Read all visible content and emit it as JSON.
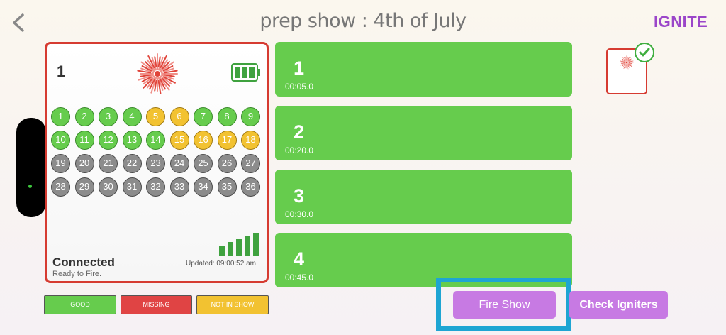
{
  "header": {
    "title": "prep show :  4th of July",
    "brand": "IGNITE"
  },
  "module": {
    "number": "1",
    "status_title": "Connected",
    "status_subtitle": "Ready to Fire.",
    "updated": "Updated: 09:00:52 am",
    "cues": [
      {
        "label": "1",
        "state": "good"
      },
      {
        "label": "2",
        "state": "good"
      },
      {
        "label": "3",
        "state": "good"
      },
      {
        "label": "4",
        "state": "good"
      },
      {
        "label": "5",
        "state": "notin"
      },
      {
        "label": "6",
        "state": "notin"
      },
      {
        "label": "7",
        "state": "good"
      },
      {
        "label": "8",
        "state": "good"
      },
      {
        "label": "9",
        "state": "good"
      },
      {
        "label": "10",
        "state": "good"
      },
      {
        "label": "11",
        "state": "good"
      },
      {
        "label": "12",
        "state": "good"
      },
      {
        "label": "13",
        "state": "good"
      },
      {
        "label": "14",
        "state": "good"
      },
      {
        "label": "15",
        "state": "notin"
      },
      {
        "label": "16",
        "state": "notin"
      },
      {
        "label": "17",
        "state": "notin"
      },
      {
        "label": "18",
        "state": "notin"
      },
      {
        "label": "19",
        "state": "unused"
      },
      {
        "label": "20",
        "state": "unused"
      },
      {
        "label": "21",
        "state": "unused"
      },
      {
        "label": "22",
        "state": "unused"
      },
      {
        "label": "23",
        "state": "unused"
      },
      {
        "label": "24",
        "state": "unused"
      },
      {
        "label": "25",
        "state": "unused"
      },
      {
        "label": "26",
        "state": "unused"
      },
      {
        "label": "27",
        "state": "unused"
      },
      {
        "label": "28",
        "state": "unused"
      },
      {
        "label": "29",
        "state": "unused"
      },
      {
        "label": "30",
        "state": "unused"
      },
      {
        "label": "31",
        "state": "unused"
      },
      {
        "label": "32",
        "state": "unused"
      },
      {
        "label": "33",
        "state": "unused"
      },
      {
        "label": "34",
        "state": "unused"
      },
      {
        "label": "35",
        "state": "unused"
      },
      {
        "label": "36",
        "state": "unused"
      }
    ]
  },
  "legend": {
    "good": "GOOD",
    "missing": "MISSING",
    "not_in_show": "NOT IN SHOW"
  },
  "cue_list": [
    {
      "number": "1",
      "time": "00:05.0"
    },
    {
      "number": "2",
      "time": "00:20.0"
    },
    {
      "number": "3",
      "time": "00:30.0"
    },
    {
      "number": "4",
      "time": "00:45.0"
    }
  ],
  "buttons": {
    "fire_show": "Fire Show",
    "check_igniters": "Check Igniters"
  },
  "colors": {
    "good": "#66cc4d",
    "missing": "#e04444",
    "not_in_show": "#f2c231",
    "unused": "#8c8c8c",
    "accent": "#c77ae3",
    "brand": "#9b46c9",
    "module_border": "#d63b31",
    "highlight": "#1ea5d3"
  },
  "icons": {
    "back": "chevron-left-icon",
    "burst": "firework-burst-icon",
    "battery": "battery-full-icon",
    "signal": "signal-strength-icon",
    "check": "checkmark-icon"
  }
}
